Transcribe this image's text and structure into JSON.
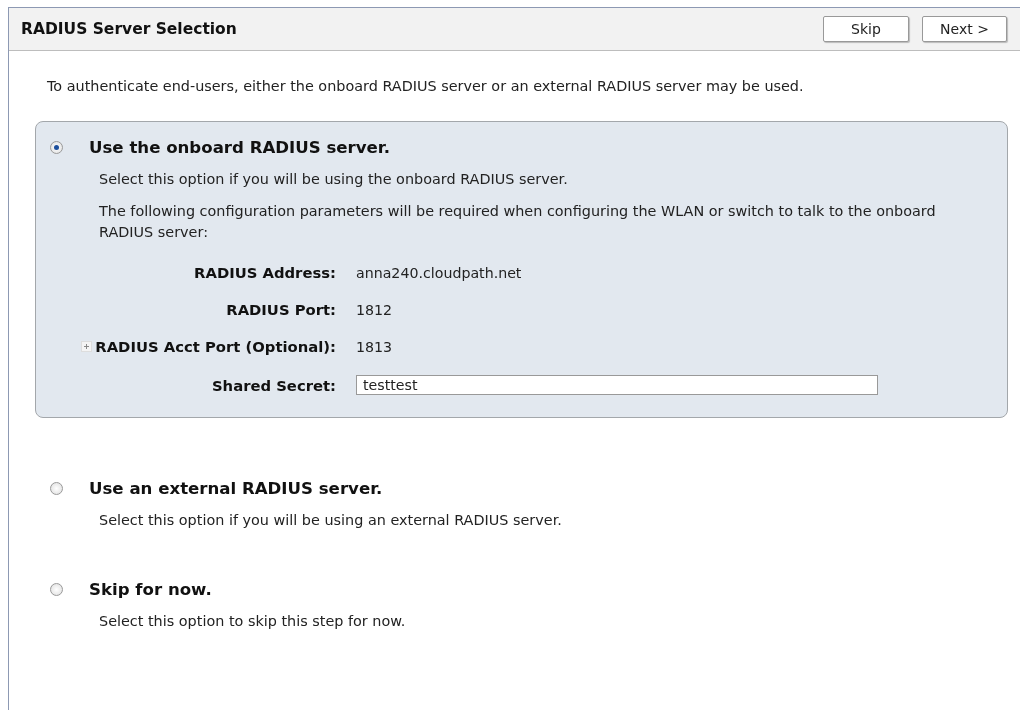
{
  "header": {
    "title": "RADIUS Server Selection",
    "buttons": [
      "Skip",
      "Next >"
    ]
  },
  "intro": "To authenticate end-users, either the onboard RADIUS server or an external RADIUS server may be used.",
  "options": [
    {
      "title": "Use the onboard RADIUS server.",
      "selected": true,
      "description": "Select this option if you will be using the onboard RADIUS server.",
      "note": "The following configuration parameters will be required when configuring the WLAN or switch to talk to the onboard RADIUS server:",
      "fields": [
        {
          "kind": "text",
          "label": "RADIUS Address:",
          "value": "anna240.cloudpath.net",
          "expandable": false
        },
        {
          "kind": "text",
          "label": "RADIUS Port:",
          "value": "1812",
          "expandable": false
        },
        {
          "kind": "text",
          "label": "RADIUS Acct Port (Optional):",
          "value": "1813",
          "expandable": true
        },
        {
          "kind": "input",
          "label": "Shared Secret:",
          "value": "testtest",
          "expandable": false
        }
      ]
    },
    {
      "title": "Use an external RADIUS server.",
      "selected": false,
      "description": "Select this option if you will be using an external RADIUS server."
    },
    {
      "title": "Skip for now.",
      "selected": false,
      "description": "Select this option to skip this step for now."
    }
  ]
}
